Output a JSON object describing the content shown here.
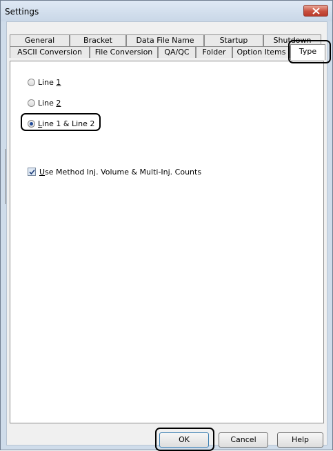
{
  "window": {
    "title": "Settings",
    "close_icon": "close-icon"
  },
  "tabs_row1": [
    {
      "label": "General"
    },
    {
      "label": "Bracket"
    },
    {
      "label": "Data File Name"
    },
    {
      "label": "Startup"
    },
    {
      "label": "Shutdown"
    }
  ],
  "tabs_row2": [
    {
      "label": "ASCII Conversion"
    },
    {
      "label": "File Conversion"
    },
    {
      "label": "QA/QC"
    },
    {
      "label": "Folder"
    },
    {
      "label": "Option Items"
    },
    {
      "label": "Type",
      "active": true
    }
  ],
  "options": {
    "line1": {
      "pre": "Line ",
      "accel": "1",
      "post": "",
      "checked": false
    },
    "line2": {
      "pre": "Line ",
      "accel": "2",
      "post": "",
      "checked": false
    },
    "both": {
      "pre": "",
      "accel": "L",
      "post": "ine 1 & Line 2",
      "checked": true
    }
  },
  "use_method": {
    "accel": "U",
    "post": "se Method Inj. Volume & Multi-Inj. Counts",
    "checked": true
  },
  "buttons": {
    "ok": "OK",
    "cancel": "Cancel",
    "help": "Help"
  },
  "colors": {
    "accent": "#214b9a",
    "close_red": "#c9503f",
    "frame": "#cfdcea"
  }
}
